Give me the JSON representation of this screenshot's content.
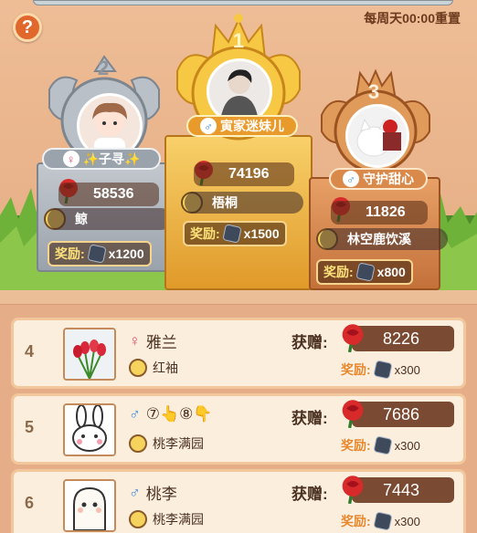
{
  "header": {
    "help_label": "?",
    "reset_text": "每周天00:00重置"
  },
  "podium": [
    {
      "rank": "2",
      "gender": "female",
      "gender_symbol": "♀",
      "name": "✨子寻✨",
      "score": "58536",
      "guild": "鲸",
      "reward_label": "奖励:",
      "reward_value": "x1200"
    },
    {
      "rank": "1",
      "gender": "male",
      "gender_symbol": "♂",
      "name": "寅家迷妹儿",
      "score": "74196",
      "guild": "梧桐",
      "reward_label": "奖励:",
      "reward_value": "x1500"
    },
    {
      "rank": "3",
      "gender": "male",
      "gender_symbol": "♂",
      "name": "守护甜心",
      "score": "11826",
      "guild": "林空鹿饮溪",
      "reward_label": "奖励:",
      "reward_value": "x800"
    }
  ],
  "list": [
    {
      "rank": "4",
      "gender_symbol": "♀",
      "name": "雅兰",
      "guild": "红袖",
      "recv_label": "获赠:",
      "score": "8226",
      "reward_label": "奖励:",
      "reward_value": "x300"
    },
    {
      "rank": "5",
      "gender_symbol": "♂",
      "name": "⑦👆⑧👇",
      "guild": "桃李满园",
      "recv_label": "获赠:",
      "score": "7686",
      "reward_label": "奖励:",
      "reward_value": "x300"
    },
    {
      "rank": "6",
      "gender_symbol": "♂",
      "name": "桃李",
      "guild": "桃李满园",
      "recv_label": "获赠:",
      "score": "7443",
      "reward_label": "奖励:",
      "reward_value": "x300"
    }
  ],
  "colors": {
    "gold": "#f2b63a",
    "silver": "#b9c0c8",
    "bronze": "#d9894a",
    "rose": "#d82a2a"
  }
}
